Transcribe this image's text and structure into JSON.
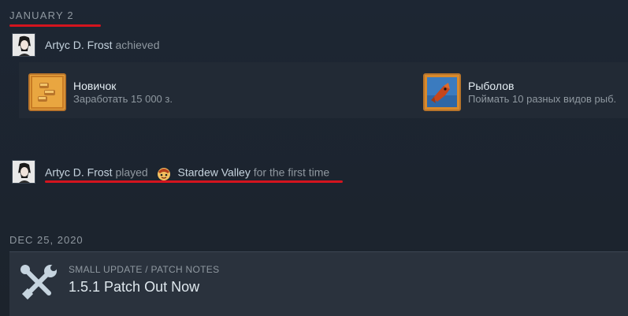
{
  "sections": [
    {
      "date": "JANUARY 2",
      "events": [
        {
          "user": "Artyc D. Frost",
          "verb": "achieved",
          "achievements": [
            {
              "title": "Новичок",
              "desc": "Заработать 15 000 з.",
              "icon": "coins-icon"
            },
            {
              "title": "Рыболов",
              "desc": "Поймать 10 разных видов рыб.",
              "icon": "fish-icon"
            }
          ]
        },
        {
          "user": "Artyc D. Frost",
          "verb": "played",
          "game": "Stardew Valley",
          "suffix": "for the first time",
          "icon": "stardew-valley-icon"
        }
      ]
    },
    {
      "date": "DEC 25, 2020",
      "news": {
        "kicker": "SMALL UPDATE / PATCH NOTES",
        "title": "1.5.1 Patch Out Now",
        "icon": "tools-icon"
      }
    }
  ],
  "colors": {
    "underline": "#d4141e",
    "background": "#1c232c",
    "accent": "#e6a23a"
  }
}
